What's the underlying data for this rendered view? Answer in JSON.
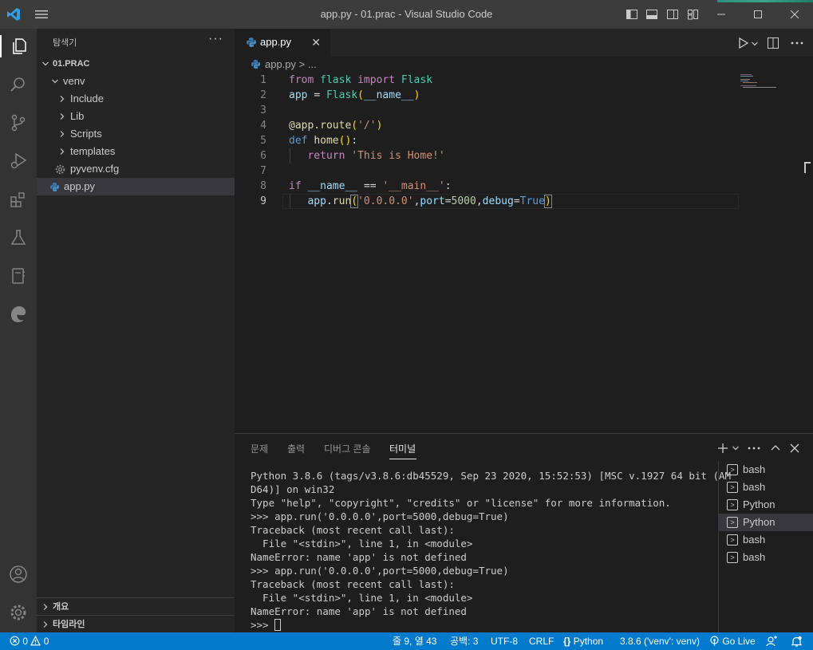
{
  "window": {
    "title": "app.py - 01.prac - Visual Studio Code"
  },
  "explorer": {
    "header": "탐색기",
    "more": "···",
    "tree": [
      {
        "label": "01.PRAC",
        "kind": "root"
      },
      {
        "label": "venv",
        "kind": "folder-open"
      },
      {
        "label": "Include",
        "kind": "folder"
      },
      {
        "label": "Lib",
        "kind": "folder"
      },
      {
        "label": "Scripts",
        "kind": "folder"
      },
      {
        "label": "templates",
        "kind": "folder"
      },
      {
        "label": "pyvenv.cfg",
        "kind": "file-cfg"
      },
      {
        "label": "app.py",
        "kind": "file-py"
      }
    ],
    "outline": "개요",
    "timeline": "타임라인"
  },
  "editor": {
    "tab": {
      "name": "app.py",
      "close": "✕"
    },
    "breadcrumb": {
      "file": "app.py",
      "sep": " > ..."
    },
    "line_numbers": [
      "1",
      "2",
      "3",
      "4",
      "5",
      "6",
      "7",
      "8",
      "9"
    ],
    "active_line": "9"
  },
  "panel": {
    "tabs": [
      "문제",
      "출력",
      "디버그 콘솔",
      "터미널"
    ],
    "active_tab": "터미널",
    "terminal_lines": [
      "Python 3.8.6 (tags/v3.8.6:db45529, Sep 23 2020, 15:52:53) [MSC v.1927 64 bit (AM",
      "D64)] on win32",
      "Type \"help\", \"copyright\", \"credits\" or \"license\" for more information.",
      ">>> app.run('0.0.0.0',port=5000,debug=True)",
      "Traceback (most recent call last):",
      "  File \"<stdin>\", line 1, in <module>",
      "NameError: name 'app' is not defined",
      ">>> app.run('0.0.0.0',port=5000,debug=True)",
      "Traceback (most recent call last):",
      "  File \"<stdin>\", line 1, in <module>",
      "NameError: name 'app' is not defined"
    ],
    "prompt": ">>> ",
    "terminals": [
      {
        "label": "bash",
        "selected": false
      },
      {
        "label": "bash",
        "selected": false
      },
      {
        "label": "Python",
        "selected": false
      },
      {
        "label": "Python",
        "selected": true
      },
      {
        "label": "bash",
        "selected": false
      },
      {
        "label": "bash",
        "selected": false
      }
    ]
  },
  "statusbar": {
    "errors": "0",
    "warnings": "0",
    "position": "줄 9, 열 43",
    "spaces": "공백: 3",
    "encoding": "UTF-8",
    "eol": "CRLF",
    "language": "Python",
    "interpreter": "3.8.6 ('venv': venv)",
    "golive": "Go Live"
  },
  "colors": {
    "accent": "#007acc",
    "titlebar": "#3c3c3c",
    "activitybar": "#333333",
    "sidebar": "#252526",
    "editor": "#1e1e1e"
  }
}
